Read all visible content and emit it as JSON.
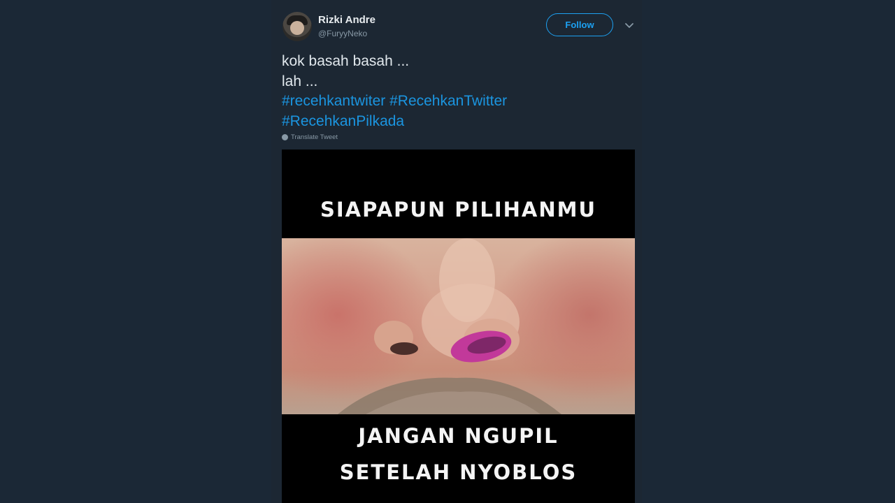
{
  "user": {
    "display_name": "Rizki Andre",
    "handle": "@FuryyNeko"
  },
  "follow_label": "Follow",
  "tweet": {
    "line1": "kok basah basah ...",
    "line2": "lah ...",
    "hashtags": [
      "#recehkantwiter",
      "#RecehkanTwitter",
      "#RecehkanPilkada"
    ]
  },
  "translate_label": "Translate Tweet",
  "meme": {
    "top_caption": "SIAPAPUN PILIHANMU",
    "bottom_line1": "JANGAN NGUPIL",
    "bottom_line2": "SETELAH NYOBLOS"
  },
  "colors": {
    "background": "#1b2836",
    "link": "#1b95e0",
    "follow": "#1da1f2",
    "ink_mark": "#c2399a"
  }
}
